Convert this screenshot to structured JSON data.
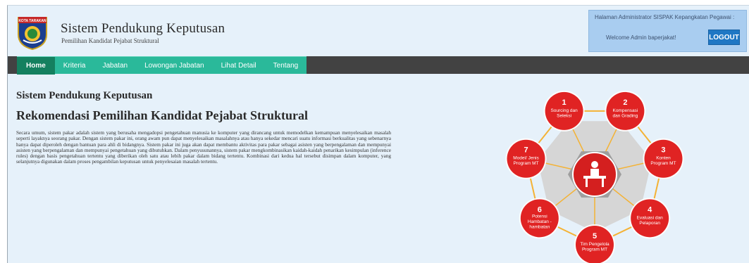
{
  "header": {
    "title": "Sistem Pendukung Keputusan",
    "subtitle": "Pemilihan Kandidat Pejabat Struktural",
    "logo_text": "KOTA TARAKAN"
  },
  "admin": {
    "heading": "Halaman Administrator SISPAK Kepangkatan Pegawai :",
    "welcome": "Welcome Admin baperjakat!",
    "logout_label": "LOGOUT"
  },
  "nav": {
    "items": [
      {
        "label": "Home"
      },
      {
        "label": "Kriteria"
      },
      {
        "label": "Jabatan"
      },
      {
        "label": "Lowongan Jabatan"
      },
      {
        "label": "Lihat Detail"
      },
      {
        "label": "Tentang"
      }
    ]
  },
  "main": {
    "title": "Sistem Pendukung Keputusan",
    "heading": "Rekomendasi Pemilihan Kandidat Pejabat Struktural",
    "paragraph": "Secara umum, sistem pakar adalah sistem yang berusaha mengadopsi pengetahuan manusia ke komputer yang dirancang untuk memodelkan kemampuan menyelesaikan masalah seperti layaknya seorang pakar. Dengan sistem pakar ini, orang awam pun dapat menyelesaikan masalahnya atau hanya sekedar mencari suatu informasi berkualitas yang sebenarnya hanya dapat diperoleh dengan bantuan para ahli di bidangnya. Sistem pakar ini juga akan dapat membantu aktivitas para pakar sebagai asisten yang berpengalaman dan mempunyai asisten yang berpengalaman dan mempunyai pengetahuan yang dibutuhkan. Dalam penyusunannya, sistem pakar mengkombinasikan kaidah-kaidah penarikan kesimpulan (inference rules) dengan basis pengetahuan tertentu yang diberikan oleh satu atau lebih pakar dalam bidang tertentu. Kombinasi dari kedua hal tersebut disimpan dalam komputer, yang selanjutnya digunakan dalam proses pengambilan keputusan untuk penyelesaian masalah tertentu."
  },
  "diagram": {
    "nodes": [
      {
        "num": "1",
        "lines": [
          "Sourcing dan",
          "Seleksi"
        ]
      },
      {
        "num": "2",
        "lines": [
          "Kompensasi",
          "dan Grading"
        ]
      },
      {
        "num": "3",
        "lines": [
          "Konten",
          "Program MT"
        ]
      },
      {
        "num": "4",
        "lines": [
          "Evaluasi dan",
          "Pelaporan"
        ]
      },
      {
        "num": "5",
        "lines": [
          "Tim Pengelola",
          "Program MT"
        ]
      },
      {
        "num": "6",
        "lines": [
          "Potensi",
          "Hambatan -",
          "hambatan"
        ]
      },
      {
        "num": "7",
        "lines": [
          "Model/ Jenis",
          "Program MT"
        ]
      }
    ],
    "colors": {
      "node": "#e02323",
      "ring": "#f4b234",
      "center": "#d41f1f"
    }
  }
}
